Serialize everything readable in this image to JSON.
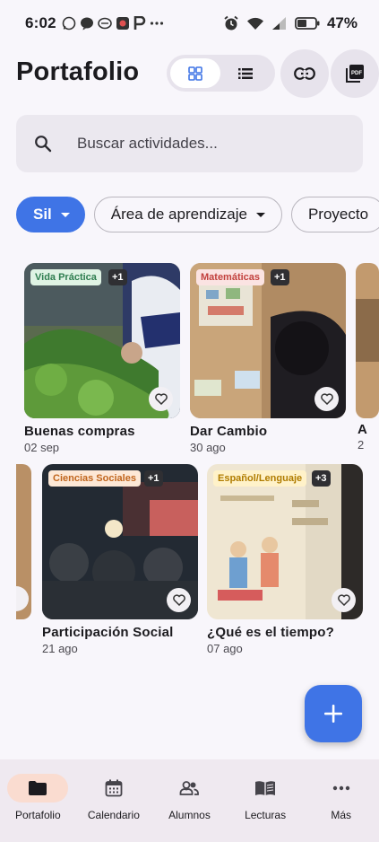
{
  "status_bar": {
    "time": "6:02",
    "battery": "47%",
    "left_icons": [
      "whatsapp-icon",
      "messenger-icon",
      "chat-icon",
      "app-icon",
      "p-letter-icon",
      "more-dots-icon"
    ],
    "right_icons": [
      "alarm-icon",
      "wifi-icon",
      "signal-icon",
      "battery-icon"
    ]
  },
  "header": {
    "title": "Portafolio",
    "view_modes": [
      "grid",
      "list"
    ],
    "active_view": "grid"
  },
  "search": {
    "placeholder": "Buscar actividades..."
  },
  "filters": [
    {
      "label": "Sil",
      "selected": true
    },
    {
      "label": "Área de aprendizaje",
      "selected": false
    },
    {
      "label": "Proyecto",
      "selected": false
    }
  ],
  "activities": [
    {
      "title": "Buenas compras",
      "date": "02 sep",
      "tag": "Vida Práctica",
      "tag_color": "#dff3e4",
      "tag_text": "#2e7d4f",
      "extra": "+1"
    },
    {
      "title": "Dar Cambio",
      "date": "30 ago",
      "tag": "Matemáticas",
      "tag_color": "#fbe3e2",
      "tag_text": "#c2403d",
      "extra": "+1"
    },
    {
      "title": "A",
      "date": "2"
    },
    {
      "title": "Participación Social",
      "date": "21 ago",
      "tag": "Ciencias Sociales",
      "tag_color": "#fde8d6",
      "tag_text": "#c0651d",
      "extra": "+1"
    },
    {
      "title": "¿Qué es el tiempo?",
      "date": "07 ago",
      "tag": "Español/Lenguaje",
      "tag_color": "#fff2c9",
      "tag_text": "#b07c00",
      "extra": "+3"
    }
  ],
  "fab": {
    "icon": "add-icon"
  },
  "bottom_nav": [
    {
      "label": "Portafolio",
      "icon": "folder-icon",
      "active": true
    },
    {
      "label": "Calendario",
      "icon": "calendar-icon",
      "active": false
    },
    {
      "label": "Alumnos",
      "icon": "people-icon",
      "active": false
    },
    {
      "label": "Lecturas",
      "icon": "book-icon",
      "active": false
    },
    {
      "label": "Más",
      "icon": "more-icon",
      "active": false
    }
  ]
}
